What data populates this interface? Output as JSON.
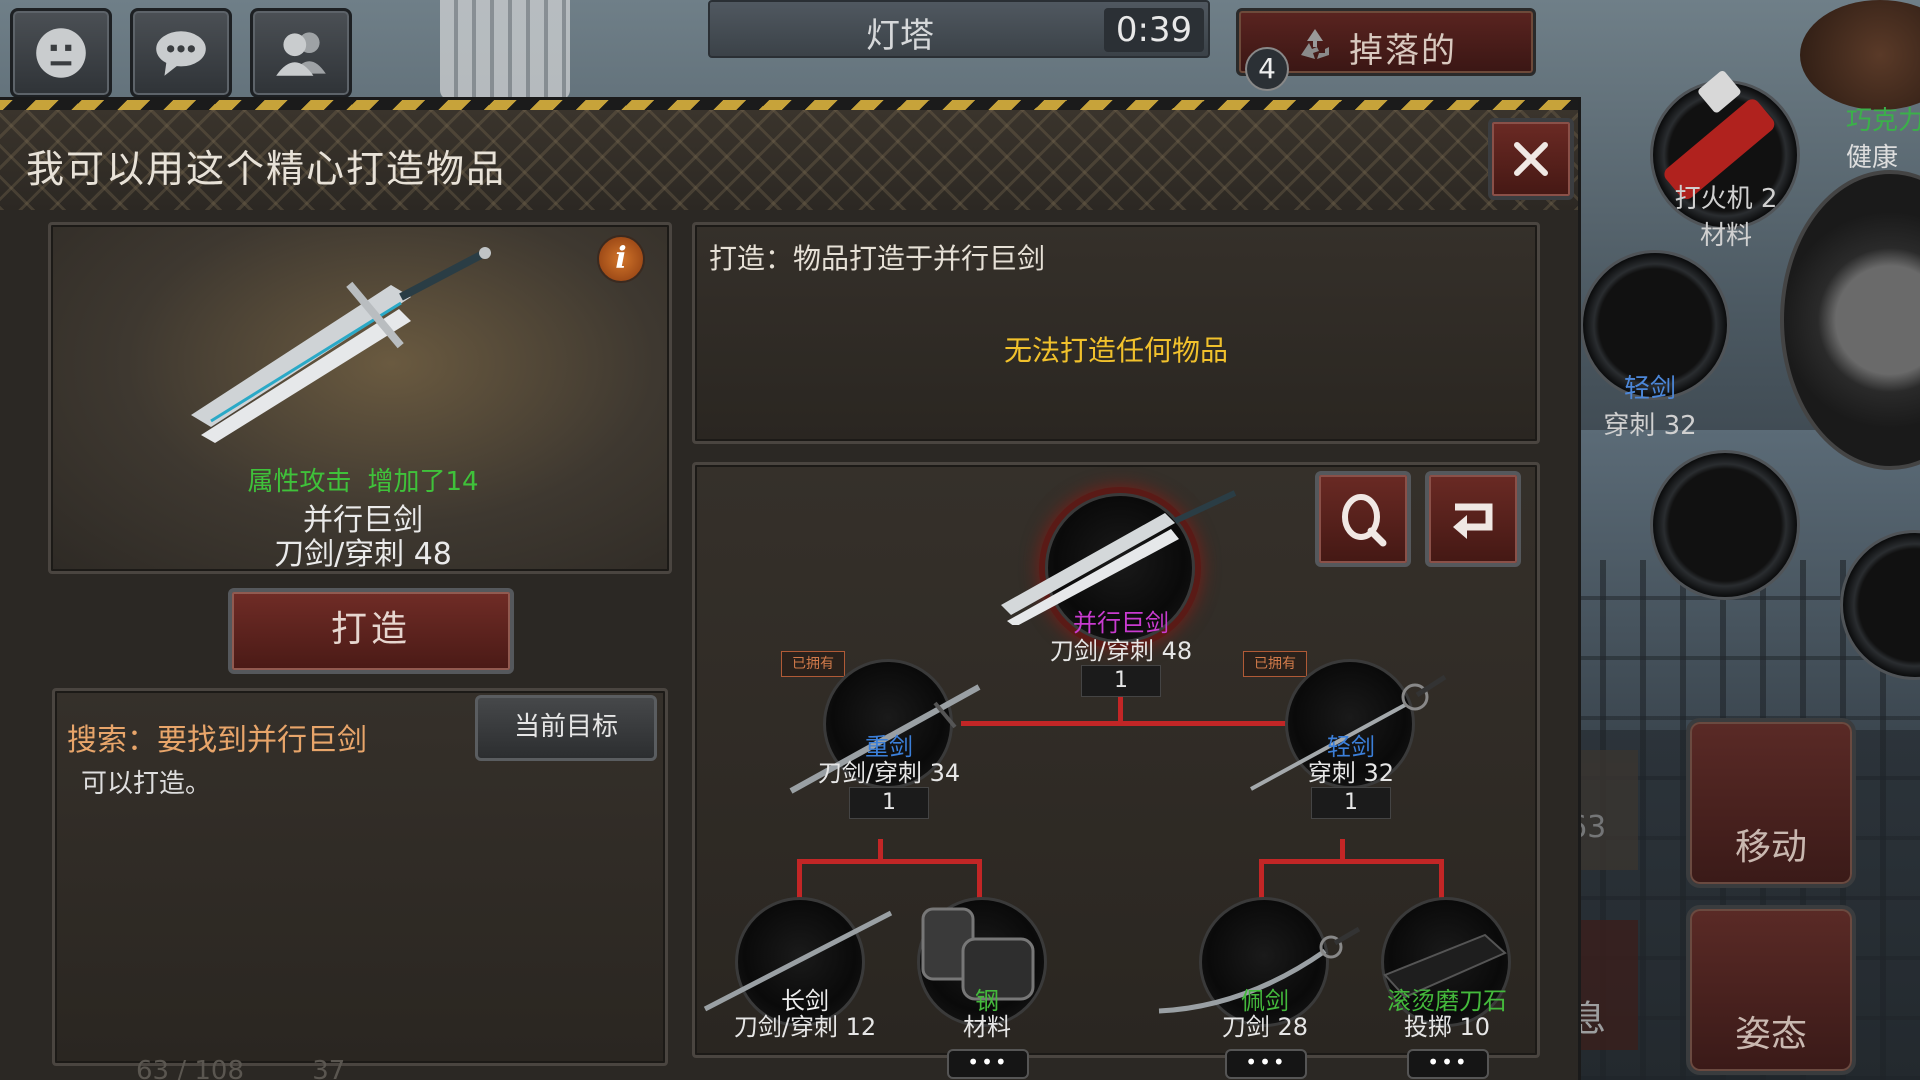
{
  "hud": {
    "location": "灯塔",
    "time": "0:39",
    "drop_label": "掉落的",
    "drop_count": "4",
    "side_items": [
      {
        "name": "打火机",
        "count": "2",
        "type": "材料"
      },
      {
        "name": "轻剑",
        "stat": "穿刺 32"
      },
      {
        "name": "巧克力",
        "type": "健康"
      }
    ],
    "move_label": "移动",
    "stance_label": "姿态",
    "partial_labels": {
      "digits": "63",
      "mid_glyph": "息",
      "status_a": "63 / 108",
      "status_b": "37"
    }
  },
  "dialog": {
    "title": "我可以用这个精心打造物品",
    "preview": {
      "attr_name": "属性攻击",
      "attr_change": "增加了14",
      "name": "并行巨剑",
      "stat": "刀剑/穿刺 48"
    },
    "craft_button": "打造",
    "search": {
      "title": "搜索：要找到并行巨剑",
      "desc": "可以打造。",
      "target_button": "当前目标"
    },
    "craft_info": {
      "title": "打造：物品打造于并行巨剑",
      "message": "无法打造任何物品"
    },
    "tree": {
      "owned_tag": "已拥有",
      "more": "•••",
      "root": {
        "name": "并行巨剑",
        "stat": "刀剑/穿刺 48",
        "qty": "1"
      },
      "left": {
        "name": "重剑",
        "stat": "刀剑/穿刺 34",
        "qty": "1"
      },
      "right": {
        "name": "轻剑",
        "stat": "穿刺 32",
        "qty": "1"
      },
      "leaves": [
        {
          "name": "长剑",
          "stat": "刀剑/穿刺 12"
        },
        {
          "name": "钢",
          "stat": "材料"
        },
        {
          "name": "佩剑",
          "stat": "刀剑 28"
        },
        {
          "name": "滚烫磨刀石",
          "stat": "投掷 10"
        }
      ]
    }
  },
  "colors": {
    "rare_purple": "#c93bd0",
    "uncommon_blue": "#3b7fd9",
    "common_green": "#44b93c",
    "warning_yellow": "#f1c12c",
    "accent_red": "#c22626"
  }
}
